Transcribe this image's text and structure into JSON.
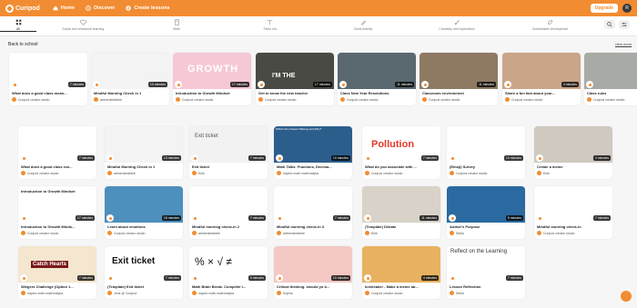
{
  "app": {
    "name": "Curipod"
  },
  "nav": {
    "home": "Home",
    "discover": "Discover",
    "create": "Create lessons",
    "upgrade": "Upgrade",
    "avatar": "R"
  },
  "categories": [
    {
      "label": "All",
      "icon": "grid-icon"
    },
    {
      "label": "Social and emotional learning",
      "icon": "heart-icon"
    },
    {
      "label": "Math",
      "icon": "calculator-icon"
    },
    {
      "label": "Fictio n/a",
      "icon": "book-icon"
    },
    {
      "label": "Book Activity",
      "icon": "pen-icon"
    },
    {
      "label": "Creativity and exploration",
      "icon": "brush-icon"
    },
    {
      "label": "Sustainable development",
      "icon": "leaf-icon"
    }
  ],
  "section": {
    "title": "Back to school",
    "view_more": "view more"
  },
  "row1": [
    {
      "title": "What does a good class mean...",
      "author": "Curipod creator studio",
      "duration": "7 minutes",
      "bg": "#ffffff"
    },
    {
      "title": "Mindful Morning Check in 1",
      "author": "aelnemkrtabble",
      "duration": "13 minutes",
      "bg": "#f3f3f3"
    },
    {
      "title": "Introduction to Growth Mindset",
      "author": "Curipod creator studio",
      "duration": "17 minutes",
      "bg": "#f6c8d5"
    },
    {
      "title": "Get to know the new teacher",
      "author": "Curipod creator studio",
      "duration": "17 minutes",
      "bg": "#4a4a44"
    },
    {
      "title": "Class New Year Resolutions",
      "author": "Curipod creator studio",
      "duration": "11 minutes",
      "bg": "#5a6870"
    },
    {
      "title": "Classroom environment",
      "author": "Curipod creator studio",
      "duration": "11 minutes",
      "bg": "#8e7a63"
    },
    {
      "title": "Share a fun fact about your...",
      "author": "Curipod creator studio",
      "duration": "4 minutes",
      "bg": "#c9a58a"
    },
    {
      "title": "Class rules",
      "author": "Curipod creator studio",
      "duration": "11 minutes",
      "bg": "#a7aaa5"
    }
  ],
  "rows": [
    [
      {
        "title": "What does a good class roo...",
        "author": "Curipod creator studio",
        "duration": "7 minutes",
        "bg": "#ffffff"
      },
      {
        "title": "Mindful Morning Check in 1",
        "author": "aelnemkrtabble",
        "duration": "13 minutes",
        "bg": "#f3f3f3"
      },
      {
        "title": "Exit ticket",
        "author": "Eirik",
        "duration": "7 minutes",
        "bg": "#f2f2f2"
      },
      {
        "title": "Math Talks: Fractions, Decima...",
        "author": "inspire.math.matematyka",
        "duration": "10 minutes",
        "bg": "#2c5e8c"
      },
      {
        "title": "What do you associate with ...",
        "author": "Curipod creator studio",
        "duration": "7 minutes",
        "bg": "#ffffff"
      },
      {
        "title": "(Emoji) Survey",
        "author": "Curipod creator studio",
        "duration": "10 minutes",
        "bg": "#ffffff"
      },
      {
        "title": "Create a meme",
        "author": "Eirik",
        "duration": "4 minutes",
        "bg": "#cfc9c0"
      }
    ],
    [
      {
        "title": "Introduction to Growth Minds...",
        "author": "Curipod creator studio",
        "duration": "17 minutes",
        "bg": "#ffffff"
      },
      {
        "title": "Learn about emotions",
        "author": "Curipod creator studio",
        "duration": "18 minutes",
        "bg": "#4d8fbd"
      },
      {
        "title": "Mindful morning check-in 2",
        "author": "aelnemkrtabble",
        "duration": "7 minutes",
        "bg": "#ffffff"
      },
      {
        "title": "Mindful morning check-in 3",
        "author": "aelnemkrtabble",
        "duration": "7 minutes",
        "bg": "#ffffff"
      },
      {
        "title": "(Template) Debate",
        "author": "Eirik",
        "duration": "11 minutes",
        "bg": "#d8d2c8"
      },
      {
        "title": "Author's Purpose",
        "author": "Stella",
        "duration": "5 minutes",
        "bg": "#2a6aa0"
      },
      {
        "title": "Mindful morning check-in",
        "author": "Curipod creator studio",
        "duration": "7 minutes",
        "bg": "#ffffff"
      }
    ],
    [
      {
        "title": "Weigers Challenge (Option 1...",
        "author": "inspire.math.matematyka",
        "duration": "7 minutes",
        "bg": "#f4e6cf"
      },
      {
        "title": "(Template) Exit ticket",
        "author": "Jens @ Curipod",
        "duration": "7 minutes",
        "bg": "#ffffff"
      },
      {
        "title": "Math Brain Break. Complete t...",
        "author": "inspire.math.matematyka",
        "duration": "5 minutes",
        "bg": "#ffffff"
      },
      {
        "title": "Critical thinking. should yo b...",
        "author": "Sophie",
        "duration": "10 minutes",
        "bg": "#f4c8c4"
      },
      {
        "title": "Icebreaker - Make a meme ab...",
        "author": "Curipod creator studio",
        "duration": "4 minutes",
        "bg": "#e8b260"
      },
      {
        "title": "Lesson Reflection",
        "author": "Stella",
        "duration": "7 minutes",
        "bg": "#ffffff"
      }
    ]
  ],
  "thumbnail_text": {
    "growth": "GROWTH",
    "pollution": "Pollution",
    "exit_ticket": "Exit ticket",
    "catch_hearts": "Catch Hearts",
    "reflect": "Reflect on the Learning",
    "math_symbols": "% × √ ≠",
    "teacher_caption": "I'M THE",
    "chart_question": "Which One Doesn't Belong and Why?",
    "growth_intro": "Introduction to Growth Mindset"
  },
  "colors": {
    "brand": "#f28c32",
    "nav_text": "#ffffff"
  }
}
